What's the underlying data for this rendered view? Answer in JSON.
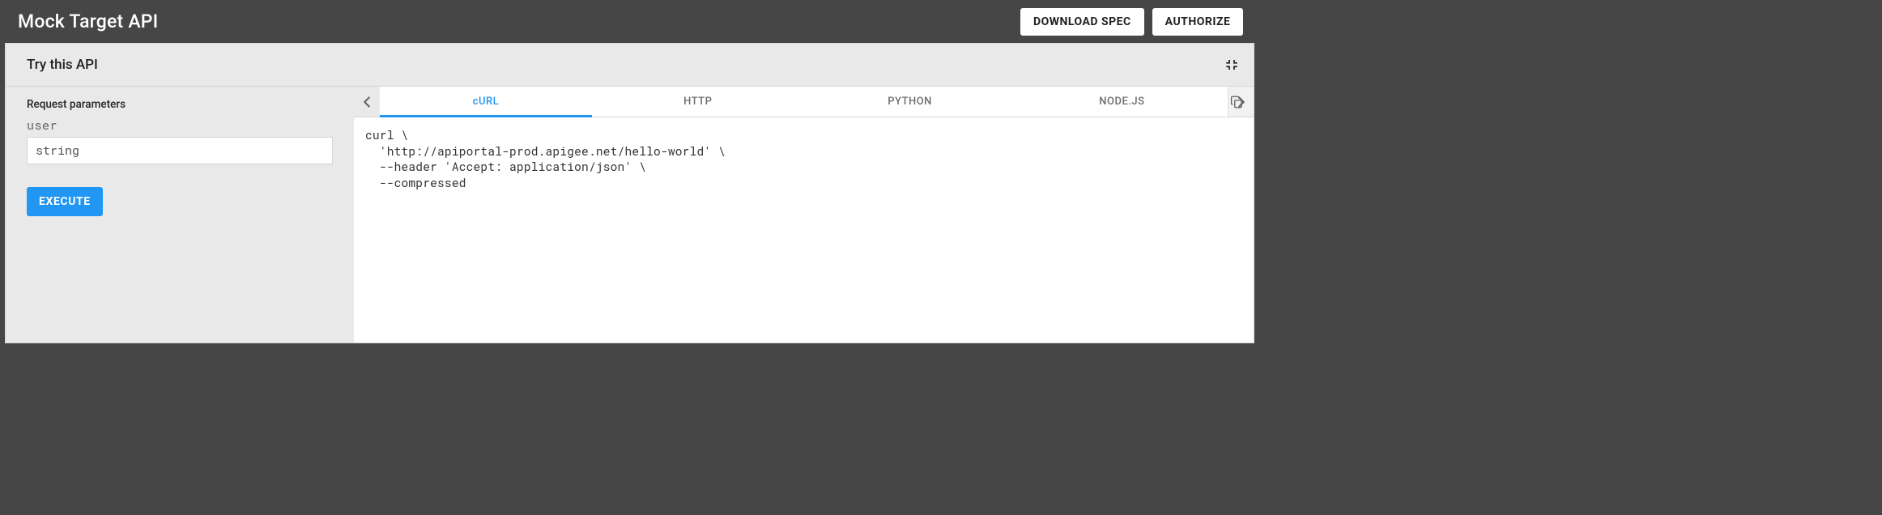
{
  "topbar": {
    "title": "Mock Target API",
    "download_label": "DOWNLOAD SPEC",
    "authorize_label": "AUTHORIZE"
  },
  "panel": {
    "title": "Try this API"
  },
  "left": {
    "section_label": "Request parameters",
    "param_name": "user",
    "placeholder": "string",
    "value": "",
    "execute_label": "EXECUTE"
  },
  "tabs": [
    "cURL",
    "HTTP",
    "PYTHON",
    "NODE.JS"
  ],
  "active_tab": 0,
  "code": "curl \\\n  'http://apiportal-prod.apigee.net/hello-world' \\\n  --header 'Accept: application/json' \\\n  --compressed"
}
